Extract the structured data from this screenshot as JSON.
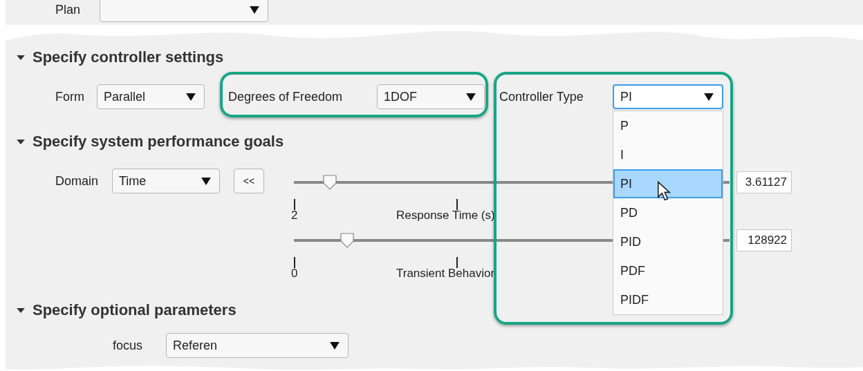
{
  "plant": {
    "label": "Plan"
  },
  "controller_settings": {
    "heading": "Specify controller settings",
    "form": {
      "label": "Form",
      "value": "Parallel"
    },
    "dof": {
      "label": "Degrees of Freedom",
      "value": "1DOF"
    },
    "controller_type": {
      "label": "Controller Type",
      "value": "PI",
      "options": [
        {
          "label": "P",
          "selected": false
        },
        {
          "label": "I",
          "selected": false
        },
        {
          "label": "PI",
          "selected": true
        },
        {
          "label": "PD",
          "selected": false
        },
        {
          "label": "PID",
          "selected": false
        },
        {
          "label": "PDF",
          "selected": false
        },
        {
          "label": "PIDF",
          "selected": false
        }
      ]
    }
  },
  "performance_goals": {
    "heading": "Specify system performance goals",
    "domain": {
      "label": "Domain",
      "value": "Time"
    },
    "collapse_button": "<<",
    "sliders": [
      {
        "level": 0.07,
        "value": "3.61127",
        "min_label": "2",
        "title": "Response Time (s)"
      },
      {
        "level": 0.11,
        "value": "128922",
        "min_label": "0",
        "title": "Transient Behavior"
      }
    ]
  },
  "optional_parameters": {
    "heading": "Specify optional parameters",
    "focus": {
      "label": "focus",
      "value": "Referen"
    }
  }
}
